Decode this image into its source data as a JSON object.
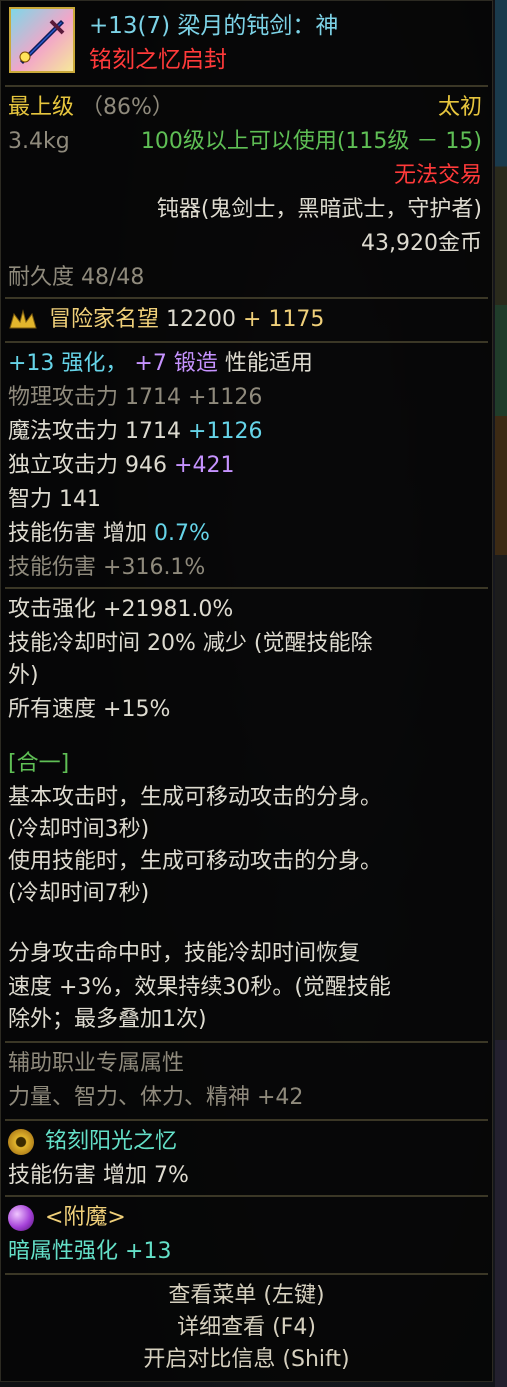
{
  "header": {
    "title": "+13(7) 梁月的钝剑：神",
    "seal": "铭刻之忆启封"
  },
  "basic": {
    "grade": "最上级",
    "grade_pct": "（86%）",
    "rarity": "太初",
    "weight": "3.4kg",
    "level_req": "100级以上可以使用(115级 － 15)",
    "trade": "无法交易",
    "weapon_type": "钝器(鬼剑士，黑暗武士，守护者)",
    "price": "43,920金币",
    "durability": "耐久度 48/48"
  },
  "fame": {
    "label": "冒险家名望",
    "value": "12200",
    "bonus": "+ 1175"
  },
  "stats": {
    "enhance": "+13 强化，",
    "forge": "+7 锻造",
    "perf": "性能适用",
    "phys_label": "物理攻击力",
    "phys_value": "1714 +1126",
    "magic_label": "魔法攻击力",
    "magic_value": "1714",
    "magic_bonus": "+1126",
    "indep_label": "独立攻击力",
    "indep_value": "946",
    "indep_bonus": "+421",
    "int_label": "智力",
    "int_value": "141",
    "skill_inc_label": "技能伤害 增加",
    "skill_inc_value": "0.7%",
    "skill_dmg_label": "技能伤害",
    "skill_dmg_value": "+316.1%"
  },
  "options": {
    "atk_boost_label": "攻击强化",
    "atk_boost_value": "+21981.0%",
    "cooldown_label": "技能冷却时间",
    "cooldown_value": "20% 减少 (觉醒技能除",
    "cooldown_value2": "外)",
    "speed_label": "所有速度",
    "speed_value": "+15%"
  },
  "set": {
    "title": "[合一]",
    "l1": "基本攻击时，生成可移动攻击的分身。",
    "l2": "(冷却时间3秒)",
    "l3": "使用技能时，生成可移动攻击的分身。",
    "l4": "(冷却时间7秒)",
    "l5": "分身攻击命中时，技能冷却时间恢复",
    "l6": "速度 +3%，效果持续30秒。(觉醒技能",
    "l7": "除外；最多叠加1次)"
  },
  "support": {
    "title": "辅助职业专属属性",
    "value": "力量、智力、体力、精神 +42"
  },
  "inscription": {
    "title": "铭刻阳光之忆",
    "label": "技能伤害 增加",
    "value": "7%"
  },
  "enchant": {
    "title": "<附魔>",
    "label": "暗属性强化",
    "value": "+13"
  },
  "footer": {
    "menu": "查看菜单 (左键)",
    "detail": "详细查看 (F4)",
    "compare": "开启对比信息 (Shift)"
  },
  "icons": {
    "item": "weapon-icon",
    "fame": "crown-icon",
    "inscription": "gear-icon",
    "enchant": "orb-icon"
  }
}
